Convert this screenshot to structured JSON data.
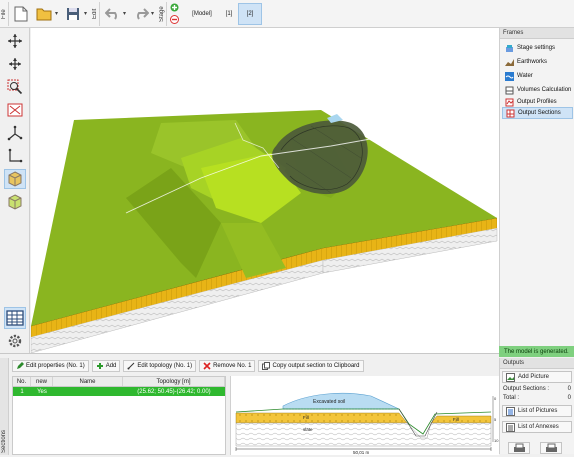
{
  "toolbar": {
    "file_label": "File",
    "edit_label": "Edit",
    "stage_label": "Stage",
    "stage_tabs": [
      "[Model]",
      "[1]",
      "[2]"
    ]
  },
  "frames": {
    "title": "Frames",
    "items": [
      {
        "label": "Stage settings",
        "icon": "stage-settings-icon"
      },
      {
        "label": "Earthworks",
        "icon": "earthworks-icon"
      },
      {
        "label": "Water",
        "icon": "water-icon"
      },
      {
        "label": "Volumes Calculation",
        "icon": "volumes-icon"
      },
      {
        "label": "Output Profiles",
        "icon": "profiles-icon"
      },
      {
        "label": "Output Sections",
        "icon": "sections-icon"
      }
    ]
  },
  "status": {
    "message": "The model is generated."
  },
  "outputs": {
    "title": "Outputs",
    "add_picture": "Add Picture",
    "output_sections_label": "Output Sections :",
    "output_sections_value": "0",
    "total_label": "Total :",
    "total_value": "0",
    "list_pictures": "List of Pictures",
    "list_annexes": "List of Annexes"
  },
  "sections": {
    "side_label": "Sections",
    "buttons": {
      "edit": "Edit properties (No. 1)",
      "add": "Add",
      "edit_topology": "Edit topology (No. 1)",
      "remove": "Remove No. 1",
      "copy": "Copy output section to Clipboard"
    },
    "table": {
      "columns": [
        "No.",
        "new",
        "Name",
        "Topology [m]"
      ],
      "rows": [
        {
          "no": "1",
          "new": "Yes",
          "name": "",
          "topology": "(25.62; 50.45)-(26.42; 0.00)"
        }
      ]
    },
    "preview": {
      "excavated_label": "Excavated soil",
      "fill_label": "Fill",
      "slate_label": "slate",
      "dimension": "50,01 m",
      "axis_ticks": [
        "0",
        "5",
        "10"
      ]
    }
  },
  "colors": {
    "terrain": "#8ab520",
    "terrain_light": "#b7e021",
    "fill_layer": "#e8b416",
    "highlight": "#2fb82f",
    "selection": "#cfe3f6"
  }
}
